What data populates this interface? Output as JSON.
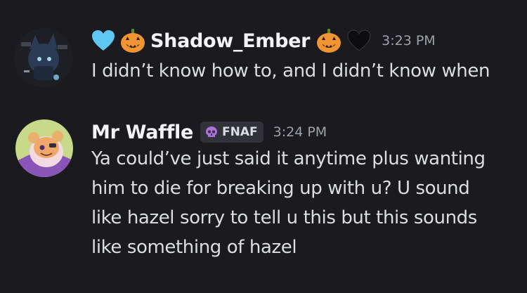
{
  "messages": [
    {
      "username": "Shadow_Ember",
      "time": "3:23 PM",
      "text": "I didn’t know how to, and I didn’t know when",
      "name_decorations": [
        "blue-heart-icon",
        "jack-o-lantern-icon",
        "jack-o-lantern-icon",
        "black-heart-icon"
      ]
    },
    {
      "username": "Mr Waffle",
      "tag": "FNAF",
      "time": "3:24 PM",
      "text_lines": [
        "Ya could’ve just said it anytime plus wanting",
        "him to die for breaking up with u? U sound",
        "like hazel sorry to tell u this but this sounds",
        "like something of hazel"
      ]
    }
  ],
  "colors": {
    "background": "#1b1b1f",
    "username": "#f2f3f5",
    "timestamp": "#9da1a8",
    "message_text": "#dbdee1",
    "tag_bg": "#303139",
    "tag_icon": "#a970d9"
  }
}
